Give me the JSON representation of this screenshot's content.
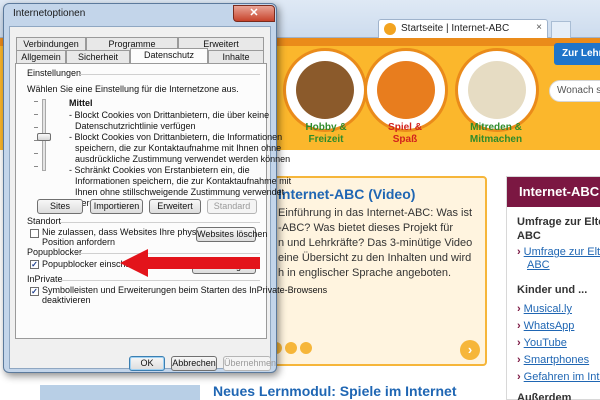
{
  "browser": {
    "tab_title": "Startseite | Internet-ABC",
    "tab_close": "×"
  },
  "site": {
    "login_label": "Zur Lehr",
    "search_placeholder": "Wonach s",
    "mascots": [
      {
        "label_line1": "Hobby &",
        "label_line2": "Freizeit",
        "color": "#2f8b2b"
      },
      {
        "label_line1": "Spiel &",
        "label_line2": "Spaß",
        "color": "#d2231e"
      },
      {
        "label_line1": "Mitreden &",
        "label_line2": "Mitmachen",
        "color": "#2f8b2b"
      }
    ],
    "content": {
      "title": "Internet-ABC (Video)",
      "body_lines": [
        "Einführung in das Internet-ABC: Was ist",
        "-ABC? Was bietet dieses Projekt für",
        "n und Lehrkräfte? Das 3-minütige Video",
        "eine Übersicht zu den Inhalten und wird",
        "h in englischer Sprache angeboten."
      ],
      "next": "›"
    },
    "bottom_heading": "Neues Lernmodul: Spiele im Internet",
    "sidebar": {
      "header": "Internet-ABC",
      "title1_line1": "Umfrage zur Elte",
      "title1_line2": "ABC",
      "link1_line1": "Umfrage zur Elt",
      "link1_line2": "ABC",
      "title2": "Kinder und ...",
      "links": [
        "Musical.ly",
        "WhatsApp",
        "YouTube",
        "Smartphones",
        "Gefahren im Inte"
      ],
      "title3": "Außerdem"
    }
  },
  "dialog": {
    "title": "Internetoptionen",
    "close": "✕",
    "tabs_row1": [
      "Verbindungen",
      "Programme",
      "Erweitert"
    ],
    "tabs_row2": [
      "Allgemein",
      "Sicherheit",
      "Datenschutz",
      "Inhalte"
    ],
    "active_tab": "Datenschutz",
    "settings_group": "Einstellungen",
    "settings_intro": "Wählen Sie eine Einstellung für die Internetzone aus.",
    "level_name": "Mittel",
    "level_description": [
      "- Blockt Cookies von Drittanbietern, die über keine",
      "Datenschutzrichtlinie verfügen",
      "- Blockt Cookies von Drittanbietern, die Informationen",
      "speichern, die zur Kontaktaufnahme mit Ihnen ohne",
      "ausdrückliche Zustimmung verwendet werden können",
      "- Schränkt Cookies von Erstanbietern ein, die",
      "Informationen speichern, die zur Kontaktaufnahme mit",
      "Ihnen ohne stillschweigende Zustimmung verwendet",
      "werden können"
    ],
    "buttons_settings": [
      "Sites",
      "Importieren",
      "Erweitert",
      "Standard"
    ],
    "location_group": "Standort",
    "location_checkbox_line1": "Nie zulassen, dass Websites Ihre physische",
    "location_checkbox_line2": "Position anfordern",
    "clear_sites_button": "Websites löschen",
    "popup_group": "Popupblocker",
    "popup_checkbox": "Popupblocker einschalten",
    "popup_settings_button": "Einstellungen",
    "inprivate_group": "InPrivate",
    "inprivate_checkbox_line1": "Symbolleisten und Erweiterungen beim Starten des InPrivate-Browsens",
    "inprivate_checkbox_line2": "deaktivieren",
    "ok": "OK",
    "cancel": "Abbrechen",
    "apply": "Übernehmen",
    "check_mark": "✓",
    "arrow_color": "#e3141b"
  }
}
